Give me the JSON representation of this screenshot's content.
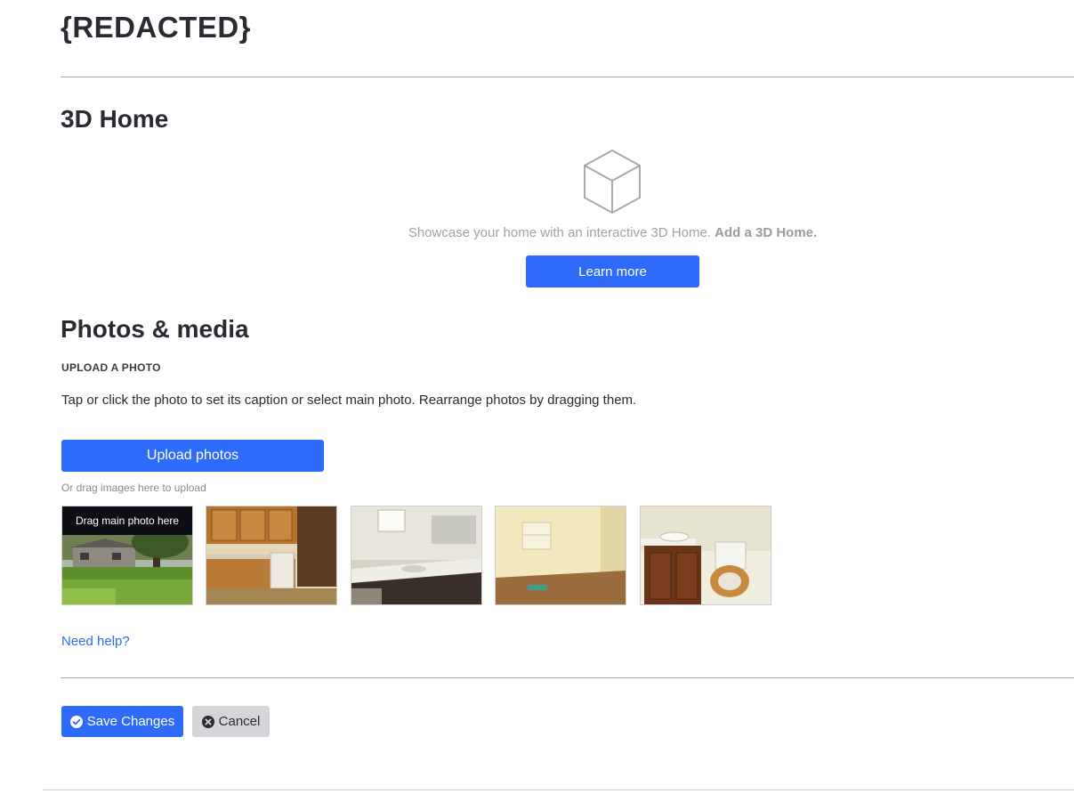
{
  "header": {
    "brand": "{REDACTED}"
  },
  "home3d": {
    "title": "3D Home",
    "icon": "cube-icon",
    "showcase_text": "Showcase your home with an interactive 3D Home.",
    "showcase_link": "Add a 3D Home.",
    "learn_more_label": "Learn more"
  },
  "photos": {
    "title": "Photos & media",
    "upload_label": "UPLOAD A PHOTO",
    "instructions": "Tap or click the photo to set its caption or select main photo. Rearrange photos by dragging them.",
    "upload_button_label": "Upload photos",
    "drag_hint": "Or drag images here to upload",
    "main_photo_tag": "Drag main photo here",
    "thumbnails": [
      {
        "name": "exterior-house-photo"
      },
      {
        "name": "kitchen-photo"
      },
      {
        "name": "bathroom-vanity-photo"
      },
      {
        "name": "empty-bedroom-photo"
      },
      {
        "name": "bathroom-toilet-photo"
      }
    ]
  },
  "help": {
    "link_label": "Need help?"
  },
  "actions": {
    "save_label": "Save Changes",
    "cancel_label": "Cancel",
    "accent_color": "#2f6bfa"
  }
}
